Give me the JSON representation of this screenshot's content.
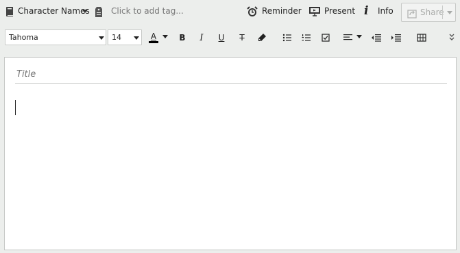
{
  "header": {
    "notebook_name": "Character Names",
    "tag_placeholder": "Click to add tag...",
    "reminder_label": "Reminder",
    "present_label": "Present",
    "info_label": "Info",
    "share_label": "Share"
  },
  "toolbar": {
    "font_family": "Tahoma",
    "font_size": "14",
    "text_color": "#000000",
    "bold_label": "B",
    "italic_label": "I",
    "underline_label": "U",
    "strike_label": "T",
    "color_label": "A"
  },
  "editor": {
    "title_placeholder": "Title",
    "body_text": ""
  },
  "icons": {
    "notebook": "notebook-icon",
    "tag": "tag-icon",
    "reminder": "alarm-clock-icon",
    "present": "presentation-icon",
    "info": "info-icon",
    "share": "share-icon"
  },
  "colors": {
    "background": "#eceeec",
    "disabled_text": "#a9aba9",
    "placeholder": "#8a8c8a"
  }
}
